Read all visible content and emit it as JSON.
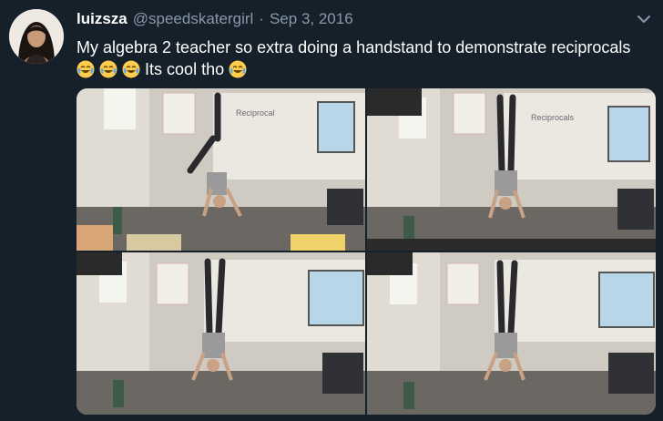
{
  "tweet": {
    "display_name": "luizsza",
    "handle": "@speedskatergirl",
    "separator": "·",
    "date": "Sep 3, 2016",
    "text_line1": "My algebra 2 teacher so extra doing a handstand to demonstrate reciprocals",
    "text_line2": "Its cool tho"
  },
  "icons": {
    "avatar": "profile-photo",
    "menu": "chevron-down-icon",
    "emoji": "face-with-tears-of-joy"
  },
  "colors": {
    "background": "#15202b",
    "secondary_text": "#8899a6",
    "primary_text": "#ffffff"
  },
  "media": {
    "photos": [
      {
        "alt": "teacher handstand photo 1"
      },
      {
        "alt": "teacher handstand photo 2"
      },
      {
        "alt": "teacher handstand photo 3"
      },
      {
        "alt": "teacher handstand photo 4"
      }
    ]
  }
}
